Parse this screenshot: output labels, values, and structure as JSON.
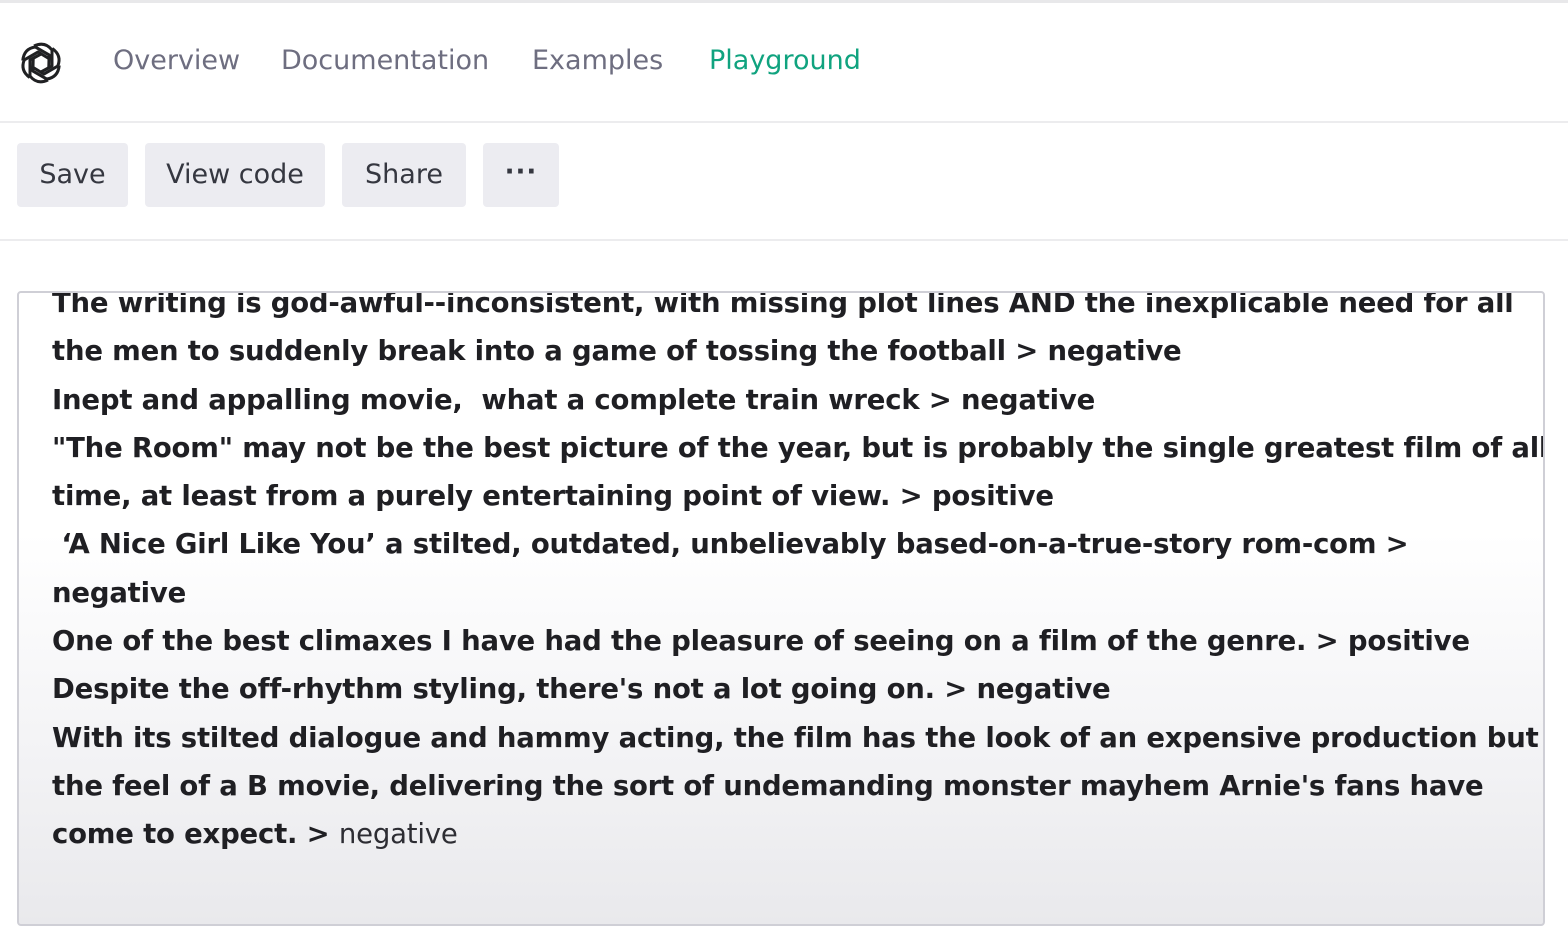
{
  "nav": {
    "items": [
      {
        "label": "Overview"
      },
      {
        "label": "Documentation"
      },
      {
        "label": "Examples"
      },
      {
        "label": "Playground"
      }
    ],
    "active_item": "Playground"
  },
  "toolbar": {
    "save_label": "Save",
    "view_code_label": "View code",
    "share_label": "Share",
    "more_label": "···"
  },
  "editor": {
    "lines": [
      "The writing is god-awful--inconsistent, with missing plot lines AND the inexplicable need for all",
      "the men to suddenly break into a game of tossing the football > negative",
      "Inept and appalling movie,  what a complete train wreck > negative",
      "\"The Room\" may not be the best picture of the year, but is probably the single greatest film of all",
      "time, at least from a purely entertaining point of view. > positive",
      " ‘A Nice Girl Like You’ a stilted, outdated, unbelievably based-on-a-true-story rom-com >",
      "negative",
      "One of the best climaxes I have had the pleasure of seeing on a film of the genre. > positive",
      "Despite the off-rhythm styling, there's not a lot going on. > negative",
      "With its stilted dialogue and hammy acting, the film has the look of an expensive production but",
      "the feel of a B movie, delivering the sort of undemanding monster mayhem Arnie's fans have"
    ],
    "last_line_prompt": "come to expect. > ",
    "last_line_completion": "negative"
  },
  "colors": {
    "accent": "#10a37f",
    "nav_text": "#6e6e80",
    "button_bg": "#ececf1",
    "editor_text": "#1f1f23"
  },
  "icons": {
    "logo": "openai-logo-icon"
  }
}
